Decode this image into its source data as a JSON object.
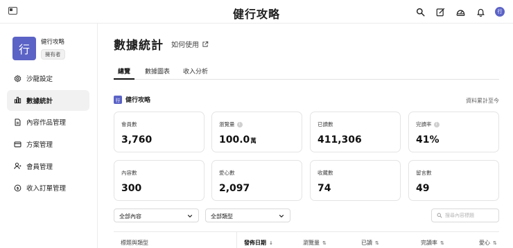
{
  "app": {
    "title": "健行攻略",
    "user_avatar": "行"
  },
  "brand": {
    "logo": "行",
    "name": "健行攻略",
    "badge": "擁有者"
  },
  "sidebar": {
    "items": [
      {
        "label": "沙龍設定",
        "icon": "gear-icon"
      },
      {
        "label": "數據統計",
        "icon": "bar-chart-icon",
        "active": true
      },
      {
        "label": "內容作品管理",
        "icon": "document-icon"
      },
      {
        "label": "方案管理",
        "icon": "card-icon"
      },
      {
        "label": "會員管理",
        "icon": "member-icon"
      },
      {
        "label": "收入訂單管理",
        "icon": "dollar-icon"
      }
    ]
  },
  "page": {
    "title": "數據統計",
    "help_link": "如何使用"
  },
  "tabs": [
    {
      "label": "總覽",
      "active": true
    },
    {
      "label": "數據圖表"
    },
    {
      "label": "收入分析"
    }
  ],
  "section": {
    "logo": "行",
    "name": "健行攻略",
    "note": "資料累計至今"
  },
  "stats": [
    {
      "label": "會員數",
      "value": "3,760"
    },
    {
      "label": "瀏覽量",
      "value": "100.0",
      "unit": "萬",
      "info": true
    },
    {
      "label": "已讀數",
      "value": "411,306"
    },
    {
      "label": "完讀率",
      "value": "41%",
      "info": true
    },
    {
      "label": "內容數",
      "value": "300"
    },
    {
      "label": "愛心數",
      "value": "2,097"
    },
    {
      "label": "收藏數",
      "value": "74"
    },
    {
      "label": "留言數",
      "value": "49"
    }
  ],
  "filters": {
    "content_select": "全部內容",
    "type_select": "全部類型",
    "search_placeholder": "搜尋內容標題"
  },
  "table": {
    "columns": [
      {
        "label": "標題與類型"
      },
      {
        "label": "發佈日期",
        "sort": "↓",
        "bold": true
      },
      {
        "label": "瀏覽量",
        "sort": "⇅"
      },
      {
        "label": "已讀",
        "sort": "⇅"
      },
      {
        "label": "完讀率",
        "sort": "⇅"
      },
      {
        "label": "愛心",
        "sort": "⇅"
      }
    ]
  },
  "colors": {
    "brand": "#5b63c6",
    "border": "#e4e4e4",
    "active_nav": "#f1f1f1"
  }
}
